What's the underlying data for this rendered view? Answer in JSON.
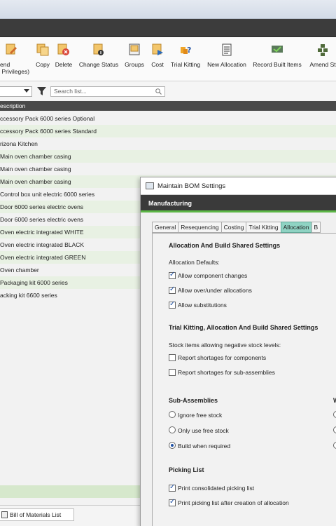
{
  "toolbar": {
    "items": [
      {
        "label": "end\n Privileges)",
        "icon": "amend-privileges-icon"
      },
      {
        "label": "Copy",
        "icon": "copy-icon"
      },
      {
        "label": "Delete",
        "icon": "delete-icon"
      },
      {
        "label": "Change Status",
        "icon": "change-status-icon"
      },
      {
        "label": "Groups",
        "icon": "groups-icon"
      },
      {
        "label": "Cost",
        "icon": "cost-icon"
      },
      {
        "label": "Trial Kitting",
        "icon": "trial-kitting-icon"
      },
      {
        "label": "New Allocation",
        "icon": "new-allocation-icon"
      },
      {
        "label": "Record Built Items",
        "icon": "record-built-items-icon"
      },
      {
        "label": "Amend St",
        "icon": "amend-stock-icon"
      }
    ]
  },
  "filter": {
    "search_placeholder": "Search list..."
  },
  "list": {
    "column_header": "escription",
    "rows": [
      "ccessory Pack 6000 series Optional",
      "ccessory Pack 6000 series Standard",
      "rizona Kitchen",
      "Main oven chamber casing",
      "Main oven chamber casing",
      "Main oven chamber casing",
      "Control box unit electric 6000 series",
      "Door 6000 series electric ovens",
      "Door 6000 series electric ovens",
      "Oven electric integrated WHITE",
      "Oven electric integrated BLACK",
      "Oven electric integrated GREEN",
      "Oven chamber",
      "Packaging kit 6000 series",
      "acking kit 6600 series"
    ]
  },
  "bottom": {
    "tab_label": "Bill of Materials List"
  },
  "dialog": {
    "title": "Maintain BOM Settings",
    "header": "Manufacturing",
    "tabs": [
      "General",
      "Resequencing",
      "Costing",
      "Trial Kitting",
      "Allocation",
      "B"
    ],
    "active_tab": "Allocation",
    "section1_title": "Allocation And Build Shared Settings",
    "allocation_defaults_label": "Allocation Defaults:",
    "allow_component_changes": "Allow component changes",
    "allow_over_under": "Allow over/under allocations",
    "allow_substitutions": "Allow substitutions",
    "section2_title": "Trial Kitting, Allocation And Build Shared Settings",
    "negative_stock_label": "Stock items allowing negative stock levels:",
    "report_shortages_components": "Report shortages for components",
    "report_shortages_subassemblies": "Report shortages for sub-assemblies",
    "subassemblies_title": "Sub-Assemblies",
    "right_column_title": "W",
    "ignore_free_stock": "Ignore free stock",
    "only_use_free_stock": "Only use free stock",
    "build_when_required": "Build when required",
    "picking_list_title": "Picking List",
    "print_consolidated": "Print consolidated picking list",
    "print_after_allocation": "Print picking list after creation of allocation"
  },
  "colors": {
    "accent_green": "#5cb746",
    "active_tab": "#8fd3c3",
    "row_alt": "#e8f1e3",
    "header_dark": "#3a3a3a"
  }
}
